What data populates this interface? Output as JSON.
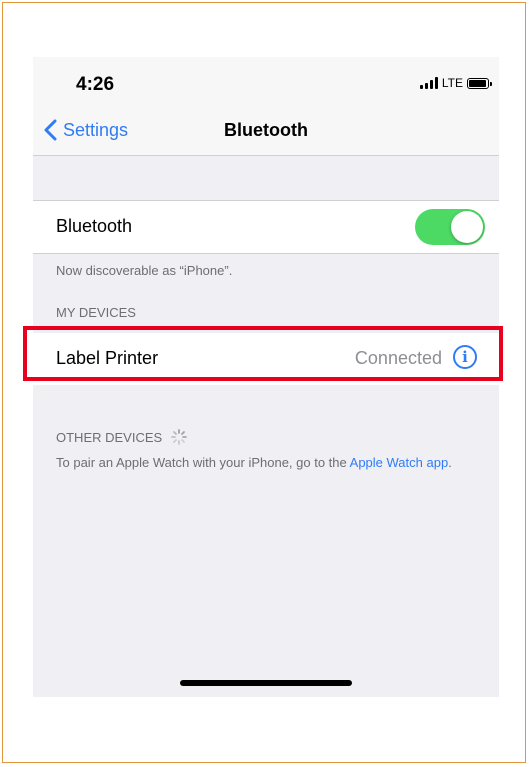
{
  "status_bar": {
    "time": "4:26",
    "network": "LTE"
  },
  "nav": {
    "back_label": "Settings",
    "title": "Bluetooth"
  },
  "bluetooth": {
    "label": "Bluetooth",
    "enabled": true,
    "footnote": "Now discoverable as “iPhone”."
  },
  "my_devices": {
    "header": "MY DEVICES",
    "items": [
      {
        "name": "Label Printer",
        "status": "Connected",
        "info_icon": "info-circle-icon"
      }
    ]
  },
  "other_devices": {
    "header": "OTHER DEVICES",
    "note_prefix": "To pair an Apple Watch with your iPhone, go to the",
    "note_link": "Apple Watch app",
    "note_suffix": "."
  },
  "colors": {
    "accent": "#2f7cf6",
    "toggle_on": "#4cd964",
    "highlight": "#e8001f",
    "frame": "#e2953a"
  }
}
